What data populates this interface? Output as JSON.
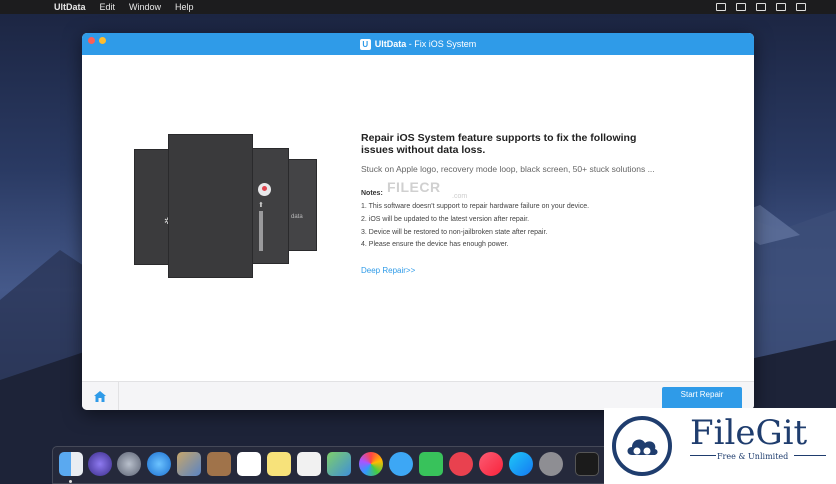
{
  "menubar": {
    "apple": "",
    "items": [
      "UltData",
      "Edit",
      "Window",
      "Help"
    ]
  },
  "window": {
    "title_app": "UltData",
    "title_rest": " - Fix iOS System",
    "logo_letter": "U"
  },
  "content": {
    "heading": "Repair iOS System feature supports to fix the following issues without data loss.",
    "subtitle": "Stuck on Apple logo, recovery mode loop, black screen, 50+ stuck solutions ...",
    "notes_label": "Notes:",
    "notes": [
      "1. This software doesn't support to repair hardware failure on your device.",
      "2. iOS will be updated to the latest version after repair.",
      "3. Device will be restored to non-jailbroken state after repair.",
      "4. Please ensure the device has enough power."
    ],
    "deep_repair": "Deep Repair>>",
    "phone_label": "data"
  },
  "watermark": {
    "filecr": "FILECR",
    "filecr_domain": ".com"
  },
  "bottombar": {
    "start_label": "Start Repair"
  },
  "filegit": {
    "title": "FileGit",
    "subtitle": "Free & Unlimited"
  },
  "colors": {
    "accent": "#2f9be8",
    "filegit": "#1f3d6e"
  }
}
